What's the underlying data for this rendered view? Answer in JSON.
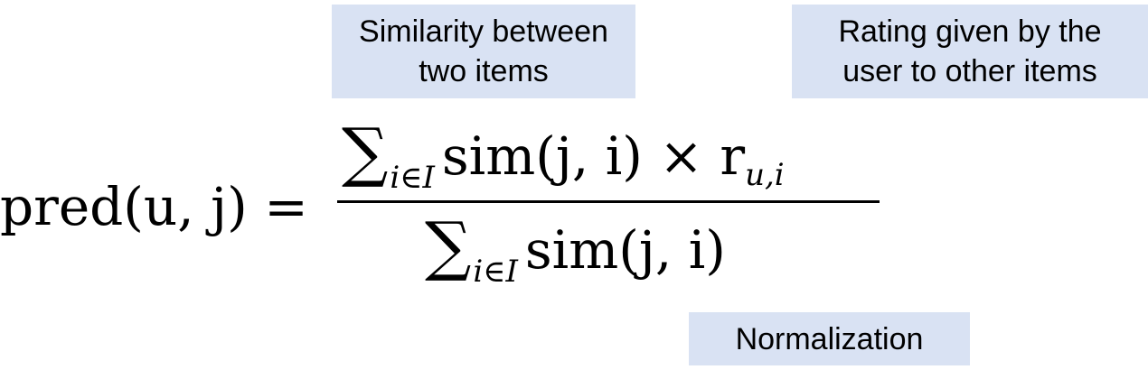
{
  "annotations": {
    "similarity": {
      "line1": "Similarity between",
      "line2": "two items"
    },
    "rating": {
      "line1": "Rating given by the",
      "line2": "user to other items"
    },
    "normalization": "Normalization"
  },
  "formula": {
    "lhs": "pred(u, j) =",
    "numerator_sum_symbol": "∑",
    "numerator_sum_index": "i∈I",
    "numerator_term": "sim(j, i) × r",
    "numerator_term_subscript": "u,i",
    "denominator_sum_symbol": "∑",
    "denominator_sum_index": "i∈I",
    "denominator_term": "sim(j, i)"
  },
  "colors": {
    "annotation_background": "#d9e2f3",
    "text": "#000000"
  }
}
